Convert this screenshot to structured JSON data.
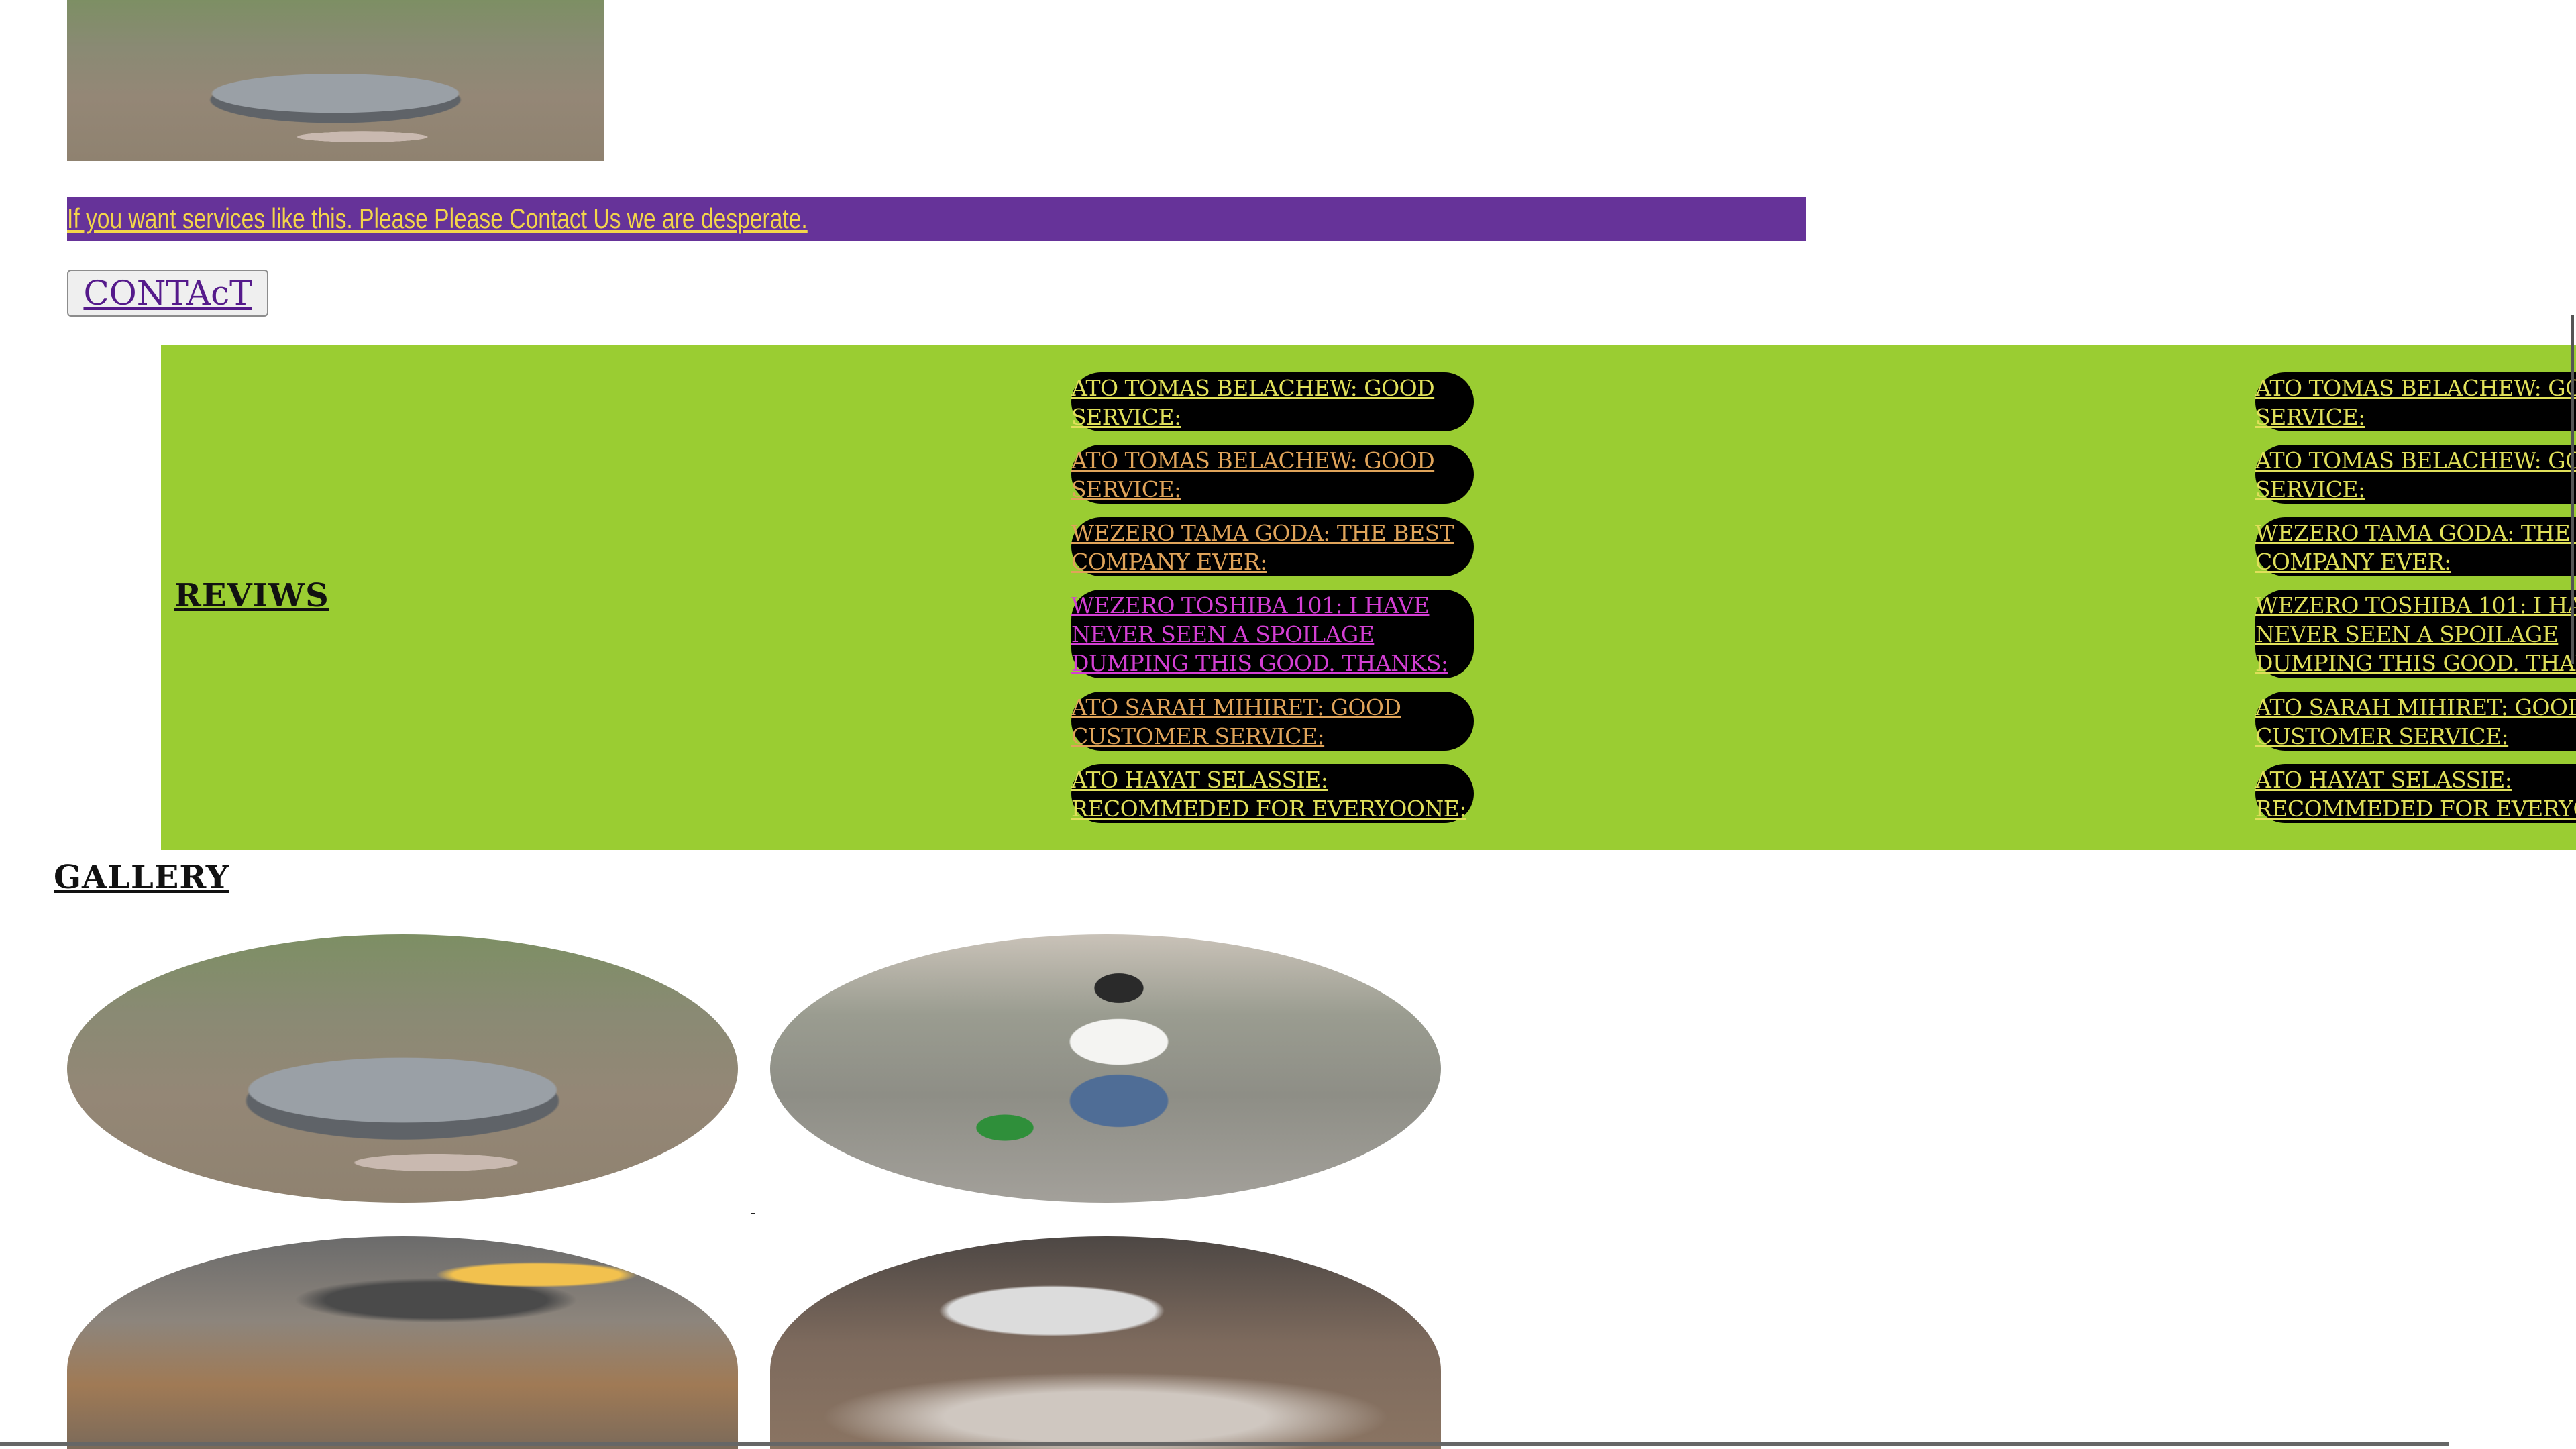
{
  "banner": {
    "link_text": "If you want services like this. Please Please Contact Us we are desperate."
  },
  "contact": {
    "label": "CONTAcT"
  },
  "reviews": {
    "title": "REVIWS",
    "items": [
      {
        "text": "ATO TOMAS BELACHEW: GOOD SERVICE:"
      },
      {
        "text": "ATO TOMAS BELACHEW: GOOD SERVICE:"
      },
      {
        "text": "WEZERO TAMA GODA: THE BEST COMPANY EVER:"
      },
      {
        "text": "WEZERO TOSHIBA 101: I HAVE NEVER SEEN A SPOILAGE DUMPING THIS GOOD. THANKS:"
      },
      {
        "text": "ATO SARAH MIHIRET: GOOD CUSTOMER SERVICE:"
      },
      {
        "text": "ATO HAYAT SELASSIE: RECOMMEDED FOR EVERYOONE:"
      }
    ]
  },
  "gallery": {
    "title": "GALLERY"
  }
}
